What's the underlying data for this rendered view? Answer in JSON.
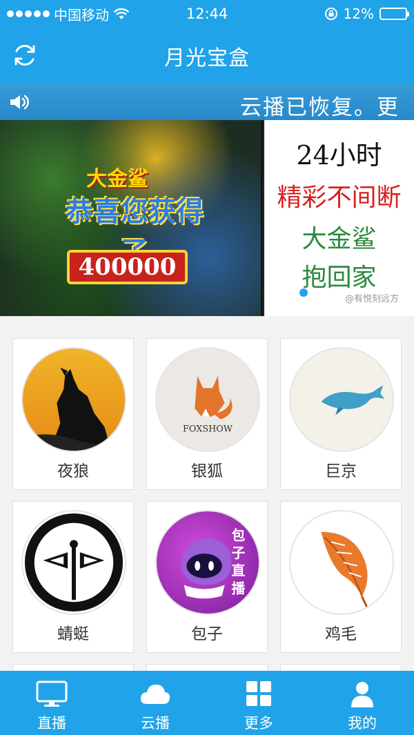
{
  "status_bar": {
    "carrier": "中国移动",
    "time": "12:44",
    "battery": "12%",
    "battery_level": 0.12
  },
  "nav": {
    "title": "月光宝盒"
  },
  "notice": {
    "text": "云播已恢复。更"
  },
  "banner": {
    "left_title": "大金鲨",
    "left_headline": "恭喜您获得了",
    "left_amount": "400000",
    "right_lines": [
      "24小时",
      "精彩不间断",
      "大金鲨",
      "抱回家"
    ],
    "watermark": "@有悦刻远方"
  },
  "channels": [
    {
      "label": "夜狼",
      "icon": "wolf-logo"
    },
    {
      "label": "银狐",
      "icon": "fox-logo",
      "logo_text": "FOXSHOW"
    },
    {
      "label": "巨京",
      "icon": "whale-logo"
    },
    {
      "label": "蜻蜓",
      "icon": "dragonfly-logo"
    },
    {
      "label": "包子",
      "icon": "baozi-mascot-logo",
      "logo_text": [
        "包",
        "子",
        "直",
        "播"
      ]
    },
    {
      "label": "鸡毛",
      "icon": "feather-logo"
    }
  ],
  "tabs": [
    {
      "label": "直播",
      "icon": "tv-icon"
    },
    {
      "label": "云播",
      "icon": "cloud-icon"
    },
    {
      "label": "更多",
      "icon": "grid-icon"
    },
    {
      "label": "我的",
      "icon": "user-icon"
    }
  ],
  "colors": {
    "brand": "#20a3e8",
    "notice_bg": "#2f90d0",
    "battery_low": "#e02020"
  }
}
